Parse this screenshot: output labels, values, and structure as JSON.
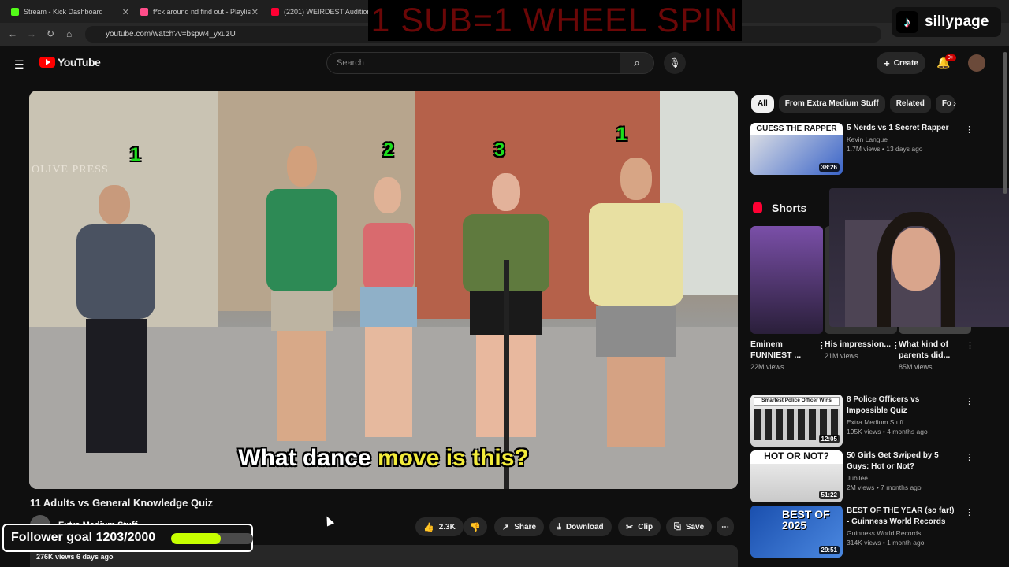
{
  "browser": {
    "tabs": [
      {
        "label": "Stream - Kick Dashboard",
        "color": "#53fc18"
      },
      {
        "label": "f*ck around nd find out - Playlis",
        "color": "#ff4e8a"
      },
      {
        "label": "(2201) WEIRDEST Auditions T",
        "color": "#ff0033"
      }
    ],
    "url": "youtube.com/watch?v=bspw4_yxuzU"
  },
  "overlay": {
    "banner": "1 SUB=1 WHEEL SPIN",
    "tiktok_name": "sillypage",
    "follower_goal_label": "Follower goal 1203/2000",
    "follower_progress": 0.6015
  },
  "header": {
    "logo_text": "YouTube",
    "search_placeholder": "Search",
    "create_label": "Create",
    "notif_badge": "9+"
  },
  "video": {
    "sign_text": "OLIVE PRESS",
    "tags": [
      "1",
      "2",
      "3",
      "1"
    ],
    "caption_pre": "What dance ",
    "caption_hl": "move is this?",
    "title": "11 Adults vs General Knowledge Quiz",
    "channel": "Extra Medium Stuff",
    "likes": "2.3K",
    "share_label": "Share",
    "download_label": "Download",
    "clip_label": "Clip",
    "save_label": "Save",
    "views_meta": "276K views  6 days ago"
  },
  "chips": [
    "All",
    "From Extra Medium Stuff",
    "Related",
    "Fo"
  ],
  "recommendations": [
    {
      "title": "5 Nerds vs 1 Secret Rapper",
      "channel": "Kevin Langue",
      "views": "1.7M views • 13 days ago",
      "duration": "38:26",
      "thumb_text": "GUESS THE RAPPER"
    },
    {
      "title": "8 Police Officers vs Impossible Quiz",
      "channel": "Extra Medium Stuff",
      "views": "195K views • 4 months ago",
      "duration": "12:05",
      "thumb_text": "Smartest Police Officer Wins"
    },
    {
      "title": "50 Girls Get Swiped by 5 Guys: Hot or Not?",
      "channel": "Jubilee",
      "views": "2M views • 7 months ago",
      "duration": "51:22",
      "thumb_text": "HOT OR NOT?"
    },
    {
      "title": "BEST OF THE YEAR (so far!) - Guinness World Records",
      "channel": "Guinness World Records",
      "views": "314K views • 1 month ago",
      "duration": "29:51",
      "thumb_text": "BEST OF 2025"
    }
  ],
  "shorts": {
    "heading": "Shorts",
    "items": [
      {
        "title": "Eminem FUNNIEST ...",
        "views": "22M views"
      },
      {
        "title": "His impression...",
        "views": "21M views"
      },
      {
        "title": "What kind of parents did...",
        "views": "85M views"
      }
    ]
  }
}
